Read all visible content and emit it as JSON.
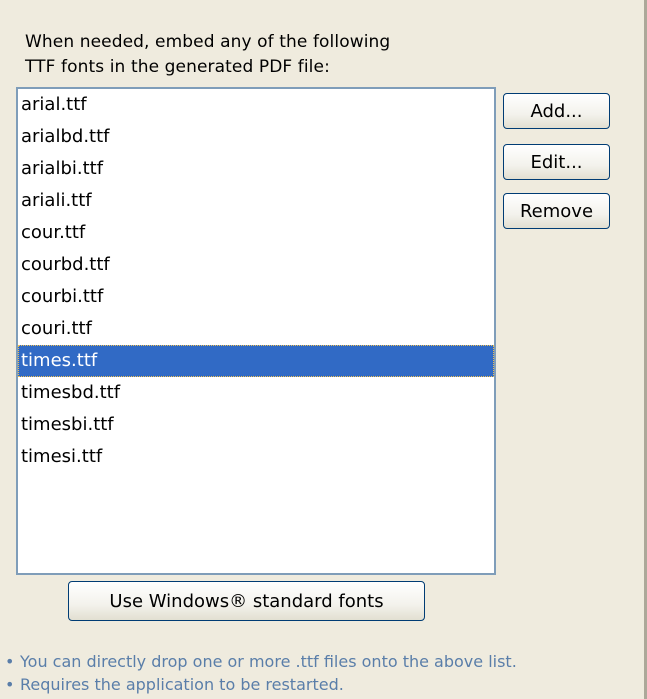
{
  "description": {
    "line1": "When needed, embed any of the following",
    "line2": "TTF fonts in the generated PDF file:"
  },
  "font_list": {
    "items": [
      "arial.ttf",
      "arialbd.ttf",
      "arialbi.ttf",
      "ariali.ttf",
      "cour.ttf",
      "courbd.ttf",
      "courbi.ttf",
      "couri.ttf",
      "times.ttf",
      "timesbd.ttf",
      "timesbi.ttf",
      "timesi.ttf"
    ],
    "selected": "times.ttf"
  },
  "buttons": {
    "add": "Add...",
    "edit": "Edit...",
    "remove": "Remove",
    "use_standard": "Use Windows® standard fonts"
  },
  "notes": {
    "bullet": "•",
    "drop_hint": "You can directly drop one or more .ttf files onto the above list.",
    "restart_hint": "Requires the application to be restarted."
  },
  "colors": {
    "panel_background": "#efebde",
    "selection": "#316ac5",
    "list_border": "#7f9db9",
    "note_text": "#5a7ea9"
  }
}
